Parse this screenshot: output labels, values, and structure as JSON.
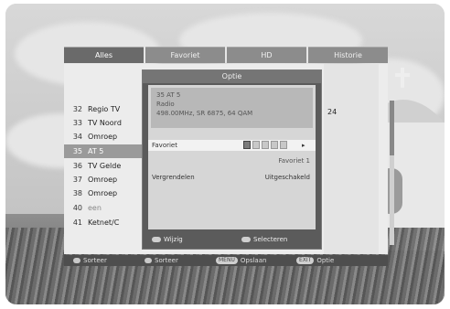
{
  "tabs": [
    "Alles",
    "Favoriet",
    "HD",
    "Historie"
  ],
  "channels": [
    {
      "num": "32",
      "name": "Regio TV"
    },
    {
      "num": "33",
      "name": "TV Noord"
    },
    {
      "num": "34",
      "name": "Omroep"
    },
    {
      "num": "35",
      "name": "AT 5"
    },
    {
      "num": "36",
      "name": "TV Gelde"
    },
    {
      "num": "37",
      "name": "Omroep"
    },
    {
      "num": "38",
      "name": "Omroep"
    },
    {
      "num": "40",
      "name": "een"
    },
    {
      "num": "41",
      "name": "Ketnet/C"
    }
  ],
  "right_number": "24",
  "dialog": {
    "title": "Optie",
    "info_line1": "35 AT 5",
    "info_line2": "Radio",
    "info_line3": "498.00MHz, SR 6875, 64 QAM",
    "favorite_label": "Favoriet",
    "favorite_sub": "Favoriet 1",
    "lock_label": "Vergrendelen",
    "lock_value": "Uitgeschakeld",
    "hint_move": "Wijzig",
    "hint_select": "Selecteren"
  },
  "legend": {
    "item1": "Sorteer",
    "item2": "Sorteer",
    "item3_key": "MENU",
    "item3": "Opslaan",
    "item4_key": "EXIT",
    "item4": "Optie"
  }
}
